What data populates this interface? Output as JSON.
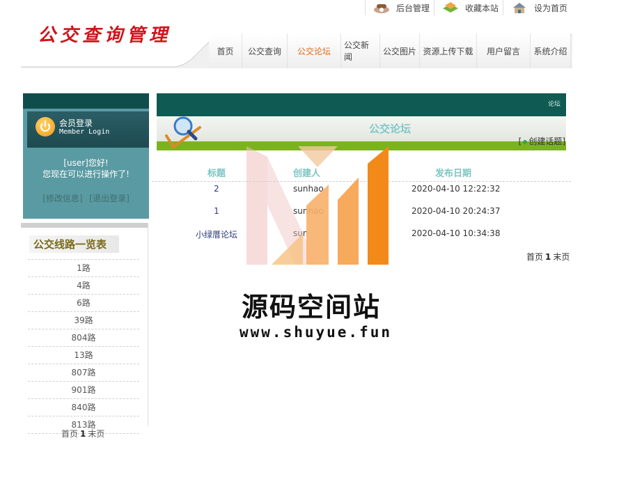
{
  "top_links": [
    {
      "label": "后台管理",
      "icon": "admin-phone-icon"
    },
    {
      "label": "收藏本站",
      "icon": "bookmark-icon"
    },
    {
      "label": "设为首页",
      "icon": "home-icon"
    }
  ],
  "logo_text": "公交查询管理",
  "nav": [
    {
      "label": "首页"
    },
    {
      "label": "公交查询"
    },
    {
      "label": "公交论坛",
      "active": true
    },
    {
      "label": "公交新闻"
    },
    {
      "label": "公交图片"
    },
    {
      "label": "资源上传下载"
    },
    {
      "label": "用户留言"
    },
    {
      "label": "系统介绍"
    }
  ],
  "login": {
    "title": "会员登录",
    "subtitle": "Member Login",
    "greeting": "[user]您好!",
    "message": "您现在可以进行操作了!",
    "edit_link": "[修改信息]",
    "logout_link": "[退出登录]"
  },
  "routes": {
    "title": "公交线路一览表",
    "items": [
      "1路",
      "4路",
      "6路",
      "39路",
      "804路",
      "13路",
      "807路",
      "901路",
      "840路",
      "813路"
    ],
    "pager": {
      "first": "首页",
      "current": "1",
      "last": "末页"
    }
  },
  "forum": {
    "title": "公交论坛",
    "corner_label": "论坛",
    "create_open": "[",
    "create_label": "创建话题]",
    "columns": {
      "title": "标题",
      "creator": "创建人",
      "date": "发布日期"
    },
    "rows": [
      {
        "title": "2",
        "creator": "sunhao",
        "date": "2020-04-10 12:22:32"
      },
      {
        "title": "1",
        "creator": "sunhao",
        "date": "2020-04-10 20:24:37"
      },
      {
        "title": "小绿厝论坛",
        "creator": "sun",
        "date": "2020-04-10 10:34:38"
      }
    ],
    "pager": {
      "first": "首页",
      "current": "1",
      "last": "末页"
    }
  },
  "watermark": {
    "title": "源码空间站",
    "url": "www.shuyue.fun"
  },
  "colors": {
    "accent_orange": "#e06a1a",
    "forum_teal": "#0f5a52",
    "forum_green": "#7bb31e",
    "login_teal": "#5a9aa2",
    "column_header": "#7cc6c2"
  }
}
